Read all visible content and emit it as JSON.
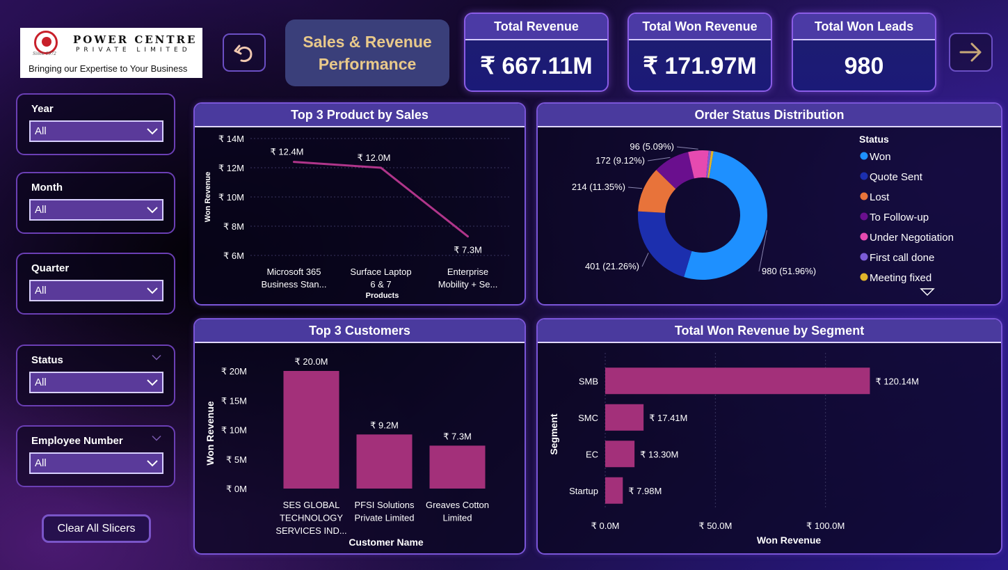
{
  "logo": {
    "name": "POWER CENTRE",
    "sub": "PRIVATE LIMITED",
    "since": "Since 1972",
    "tagline": "Bringing our Expertise to Your Business"
  },
  "header": {
    "title": "Sales & Revenue\nPerformance"
  },
  "kpis": [
    {
      "label": "Total Revenue",
      "value": "₹ 667.11M"
    },
    {
      "label": "Total Won Revenue",
      "value": "₹ 171.97M"
    },
    {
      "label": "Total Won Leads",
      "value": "980"
    }
  ],
  "slicers": [
    {
      "label": "Year",
      "value": "All"
    },
    {
      "label": "Month",
      "value": "All"
    },
    {
      "label": "Quarter",
      "value": "All"
    },
    {
      "label": "Status",
      "value": "All"
    },
    {
      "label": "Employee Number",
      "value": "All"
    }
  ],
  "clear_label": "Clear All Slicers",
  "colors": {
    "bar": "#a3307a",
    "line": "#b0358a",
    "won": "#1e90ff",
    "quote_sent": "#1c2fae",
    "lost": "#e8733a",
    "to_follow_up": "#6a0f8e",
    "under_negotiation": "#e64ab0",
    "first_call_done": "#7b5cd6",
    "meeting_fixed": "#e0b42a"
  },
  "chart_data": [
    {
      "id": "top-products",
      "type": "line",
      "title": "Top 3 Product by Sales",
      "xlabel": "Products",
      "ylabel": "Won Revenue",
      "categories": [
        "Microsoft 365 Business Stan...",
        "Surface Laptop 6 & 7",
        "Enterprise Mobility + Se..."
      ],
      "category_lines": [
        [
          "Microsoft 365",
          "Business Stan..."
        ],
        [
          "Surface Laptop",
          "6 & 7"
        ],
        [
          "Enterprise",
          "Mobility + Se..."
        ]
      ],
      "values": [
        12.4,
        12.0,
        7.3
      ],
      "data_labels": [
        "₹ 12.4M",
        "₹ 12.0M",
        "₹ 7.3M"
      ],
      "ylim": [
        6,
        14
      ],
      "yticks": [
        6,
        8,
        10,
        12,
        14
      ],
      "ytick_labels": [
        "₹ 6M",
        "₹ 8M",
        "₹ 10M",
        "₹ 12M",
        "₹ 14M"
      ],
      "grid": true
    },
    {
      "id": "order-status",
      "type": "pie",
      "title": "Order Status Distribution",
      "legend_title": "Status",
      "legend_position": "right",
      "slices": [
        {
          "label": "Won",
          "value": 980,
          "pct": "51.96%",
          "data_label": "980 (51.96%)",
          "color_key": "won"
        },
        {
          "label": "Quote Sent",
          "value": 401,
          "pct": "21.26%",
          "data_label": "401 (21.26%)",
          "color_key": "quote_sent"
        },
        {
          "label": "Lost",
          "value": 214,
          "pct": "11.35%",
          "data_label": "214 (11.35%)",
          "color_key": "lost"
        },
        {
          "label": "To Follow-up",
          "value": 172,
          "pct": "9.12%",
          "data_label": "172 (9.12%)",
          "color_key": "to_follow_up"
        },
        {
          "label": "Under Negotiation",
          "value": 96,
          "pct": "5.09%",
          "data_label": "96 (5.09%)",
          "color_key": "under_negotiation"
        },
        {
          "label": "First call done",
          "value": 12,
          "pct": "",
          "data_label": "",
          "color_key": "first_call_done"
        },
        {
          "label": "Meeting fixed",
          "value": 11,
          "pct": "",
          "data_label": "",
          "color_key": "meeting_fixed"
        }
      ]
    },
    {
      "id": "top-customers",
      "type": "bar",
      "title": "Top 3 Customers",
      "xlabel": "Customer Name",
      "ylabel": "Won Revenue",
      "categories": [
        "SES GLOBAL TECHNOLOGY SERVICES IND...",
        "PFSI Solutions Private Limited",
        "Greaves Cotton Limited"
      ],
      "category_lines": [
        [
          "SES GLOBAL",
          "TECHNOLOGY",
          "SERVICES IND..."
        ],
        [
          "PFSI Solutions",
          "Private Limited"
        ],
        [
          "Greaves Cotton",
          "Limited"
        ]
      ],
      "values": [
        20.0,
        9.2,
        7.3
      ],
      "data_labels": [
        "₹ 20.0M",
        "₹ 9.2M",
        "₹ 7.3M"
      ],
      "ylim": [
        0,
        20
      ],
      "yticks": [
        0,
        5,
        10,
        15,
        20
      ],
      "ytick_labels": [
        "₹ 0M",
        "₹ 5M",
        "₹ 10M",
        "₹ 15M",
        "₹ 20M"
      ],
      "grid": false
    },
    {
      "id": "segment-revenue",
      "type": "bar",
      "orientation": "horizontal",
      "title": "Total Won Revenue by Segment",
      "xlabel": "Won Revenue",
      "ylabel": "Segment",
      "categories": [
        "SMB",
        "SMC",
        "EC",
        "Startup"
      ],
      "values": [
        120.14,
        17.41,
        13.3,
        7.98
      ],
      "data_labels": [
        "₹ 120.14M",
        "₹ 17.41M",
        "₹ 13.30M",
        "₹ 7.98M"
      ],
      "xlim": [
        0,
        120
      ],
      "xticks": [
        0,
        50,
        100
      ],
      "xtick_labels": [
        "₹ 0.0M",
        "₹ 50.0M",
        "₹ 100.0M"
      ],
      "grid": true
    }
  ]
}
